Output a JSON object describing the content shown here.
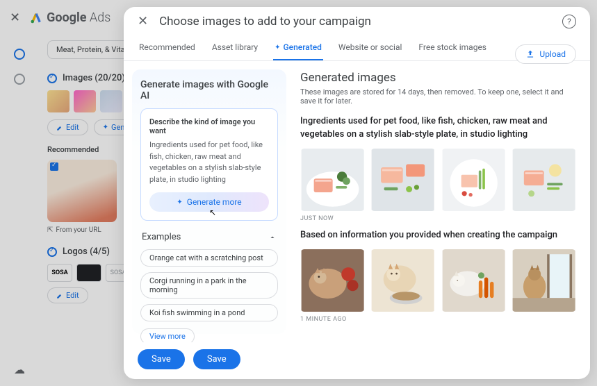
{
  "bg": {
    "brand_bold": "Google",
    "brand_light": "Ads",
    "chip": "Meat, Protein, & Vita",
    "images_section": "Images (20/20)",
    "edit": "Edit",
    "gen": "Gen",
    "recommended": "Recommended",
    "from_url": "From your URL",
    "logos_section": "Logos (4/5)",
    "logos": {
      "a": "SOSA",
      "b": "",
      "c": "SOSA"
    },
    "edit2": "Edit"
  },
  "modal": {
    "title": "Choose images to add to your campaign",
    "upload": "Upload",
    "tabs": {
      "recommended": "Recommended",
      "asset_library": "Asset library",
      "generated": "Generated",
      "website": "Website or social",
      "stock": "Free stock images"
    },
    "gen_panel": {
      "title": "Generate images with Google AI",
      "prompt_label": "Describe the kind of image you want",
      "prompt_text": "Ingredients used for pet food, like fish, chicken, raw meat and vegetables on a stylish slab-style plate, in studio lighting",
      "generate_more": "Generate more",
      "examples_label": "Examples",
      "examples": [
        "Orange cat with a scratching post",
        "Corgi running in a park in the morning",
        "Koi fish swimming in a pond"
      ],
      "view_more": "View more"
    },
    "results": {
      "title": "Generated images",
      "subtitle": "These images are stored for 14 days, then removed. To keep one, select it and save it for later.",
      "group1_title": "Ingredients used for pet food, like fish, chicken, raw meat and vegetables on a stylish slab-style plate, in studio lighting",
      "group1_time": "JUST NOW",
      "group2_title": "Based on information you provided when creating the campaign",
      "group2_time": "1 MINUTE AGO"
    },
    "save1": "Save",
    "save2": "Save"
  }
}
